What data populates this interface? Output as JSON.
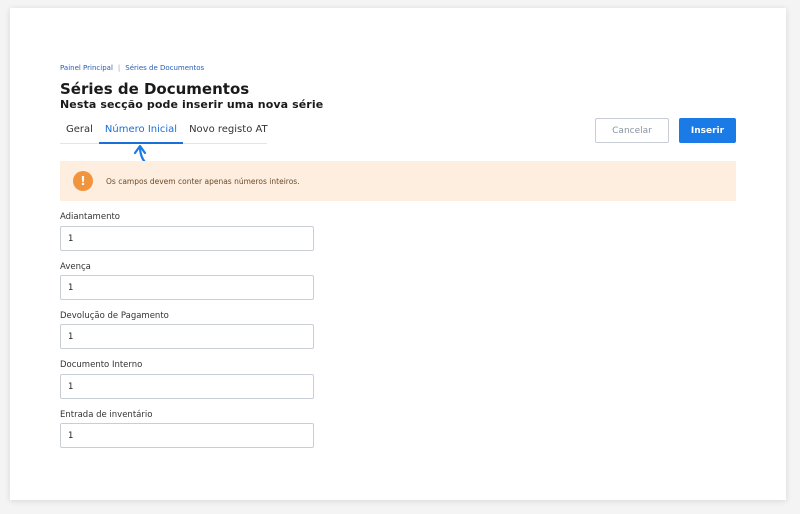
{
  "breadcrumb": {
    "home": "Painel Principal",
    "separator": "|",
    "current": "Séries de Documentos"
  },
  "page": {
    "title": "Séries de Documentos",
    "subtitle": "Nesta secção pode inserir uma nova série"
  },
  "tabs": [
    {
      "label": "Geral",
      "active": false
    },
    {
      "label": "Número Inicial",
      "active": true
    },
    {
      "label": "Novo registo AT",
      "active": false
    }
  ],
  "actions": {
    "cancel_label": "Cancelar",
    "insert_label": "Inserir"
  },
  "alert": {
    "icon": "exclamation-icon",
    "icon_glyph": "!",
    "text": "Os campos devem conter apenas números inteiros."
  },
  "fields": [
    {
      "label": "Adiantamento",
      "value": "1"
    },
    {
      "label": "Avença",
      "value": "1"
    },
    {
      "label": "Devolução de Pagamento",
      "value": "1"
    },
    {
      "label": "Documento Interno",
      "value": "1"
    },
    {
      "label": "Entrada de inventário",
      "value": "1"
    }
  ],
  "colors": {
    "accent": "#1a7be6",
    "alert_background": "#fdeee0",
    "alert_icon": "#f0953e"
  }
}
